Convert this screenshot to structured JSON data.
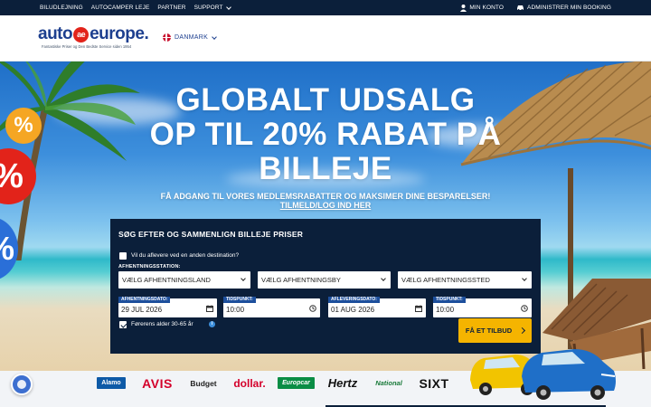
{
  "topbar": {
    "left_links": [
      "BILUDLEJNING",
      "AUTOCAMPER LEJE",
      "PARTNER",
      "SUPPORT"
    ],
    "my_account": "MIN KONTO",
    "manage_booking": "ADMINISTRER MIN BOOKING"
  },
  "header": {
    "logo_left": "auto",
    "logo_mark": "ae",
    "logo_right": "europe.",
    "tagline": "Fantastiske Priser og Den Bedste Service siden 1954",
    "country": "DANMARK"
  },
  "hero": {
    "title_lines": [
      "GLOBALT UDSALG",
      "OP TIL 20% RABAT PÅ",
      "BILLEJE"
    ],
    "subtitle_lines": [
      "FÅ ADGANG TIL VORES MEDLEMSRABATTER OG MAKSIMER DINE BESPARELSER!",
      "TILMELD/LOG IND HER"
    ],
    "badge_symbol": "%"
  },
  "search": {
    "title": "SØG EFTER OG SAMMENLIGN BILLEJE PRISER",
    "different_dropoff_label": "Vil du aflevere ved en anden destination?",
    "different_dropoff_checked": false,
    "pickup_station_label": "AFHENTNINGSSTATION:",
    "select_country": "VÆLG AFHENTNINGSLAND",
    "select_city": "VÆLG AFHENTNINGSBY",
    "select_location": "VÆLG AFHENTNINGSSTED",
    "pickup_date_label": "AFHENTNINGSDATO:",
    "pickup_date": "29 JUL 2026",
    "pickup_time_label": "TIDSPUNKT:",
    "pickup_time": "10:00",
    "dropoff_date_label": "AFLEVERINGSDATO:",
    "dropoff_date": "01 AUG 2026",
    "dropoff_time_label": "TIDSPUNKT:",
    "dropoff_time": "10:00",
    "driver_age_label": "Førerens alder 30-65 år",
    "driver_age_checked": true,
    "info_symbol": "i",
    "cta": "FÅ ET TILBUD"
  },
  "brands": [
    "Alamo",
    "AVIS",
    "Budget",
    "dollar.",
    "Europcar",
    "Hertz",
    "National",
    "SIXT"
  ],
  "colors": {
    "navy": "#0b1f3a",
    "brand_blue": "#1d3f8f",
    "cta_yellow": "#f5b400",
    "logo_red": "#e2231a"
  }
}
